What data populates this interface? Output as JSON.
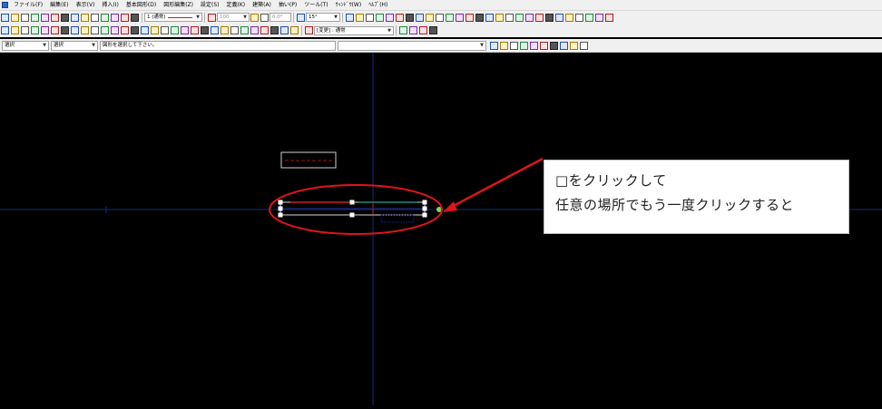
{
  "menubar": {
    "items": [
      "ファイル(F)",
      "編集(E)",
      "表示(V)",
      "挿入(I)",
      "基本図形(D)",
      "図形編集(Z)",
      "設定(S)",
      "定義(K)",
      "建築(A)",
      "抽い(P)",
      "ツール(T)",
      "ｳｨﾝﾄﾞｳ(W)",
      "ﾍﾙﾌﾟ(H)"
    ]
  },
  "toolbar1": {
    "layer_combo": "1 (通常)",
    "pen_combo": "100",
    "angle_combo": "0.0°",
    "snap_angle_combo": "15°"
  },
  "toolbar2": {
    "layer_name_combo": "[変更] : 通常"
  },
  "statusbar": {
    "mode_combo_1": "選択",
    "mode_combo_2": "選択",
    "message": "図形を選択して下さい。"
  },
  "callout": {
    "line1": "□をクリックして",
    "line2": "任意の場所でもう一度クリックすると"
  },
  "colors": {
    "canvas_bg": "#000000",
    "crosshair": "#1a2a7a",
    "ellipse": "#e0141c",
    "arrow": "#e0141c",
    "grip_handle": "#ffffff",
    "grip_hot": "#7ed957",
    "teal_line": "#1a8a7a",
    "red_line": "#c8201e"
  },
  "icons": {
    "toolbar1": [
      "new-file-icon",
      "open-folder-icon",
      "save-icon",
      "save-as-icon",
      "print-icon",
      "undo-icon",
      "redo-icon",
      "properties-icon",
      "layer-icon",
      "text-icon",
      "dimension-icon",
      "calendar-icon",
      "zoom-icon",
      "grid-icon",
      "snap-icon",
      "filter-icon",
      "table-icon",
      "pen-icon",
      "line-tool-icon",
      "polyline-icon",
      "circle-icon",
      "arc-icon",
      "rectangle-icon",
      "ellipse-icon",
      "spline-icon",
      "hatch-icon",
      "block-icon",
      "array-icon",
      "mirror-icon",
      "rotate-icon",
      "scale-icon",
      "trim-icon",
      "extend-icon",
      "offset-icon",
      "fillet-icon",
      "chamfer-icon",
      "break-icon",
      "join-icon",
      "explode-icon",
      "erase-icon",
      "window-icon"
    ],
    "toolbar2": [
      "pin-icon",
      "select-all-icon",
      "measure-icon",
      "list-icon",
      "align-left-icon",
      "align-center-icon",
      "align-right-icon",
      "distribute-icon",
      "group-icon",
      "ungroup-icon",
      "snap-end-icon",
      "snap-mid-icon",
      "snap-center-icon",
      "snap-intersection-icon",
      "snap-perpendicular-icon",
      "snap-tangent-icon",
      "snap-nearest-icon",
      "ortho-icon",
      "polar-icon",
      "osnap-icon",
      "otrack-icon",
      "dyn-icon",
      "lwt-icon",
      "model-icon",
      "layout-icon",
      "viewport-icon",
      "pan-icon",
      "zoom-window-icon",
      "zoom-extents-icon",
      "regen-icon",
      "redraw-icon",
      "layer-freeze-icon",
      "layer-lock-icon",
      "layer-color-icon"
    ],
    "statusbar": [
      "snap-toggle-icon",
      "grid-toggle-icon",
      "ortho-toggle-icon",
      "polar-toggle-icon",
      "osnap-toggle-icon",
      "track-toggle-icon",
      "lineweight-toggle-icon",
      "model-toggle-icon",
      "quick-props-icon",
      "annotation-icon"
    ]
  }
}
